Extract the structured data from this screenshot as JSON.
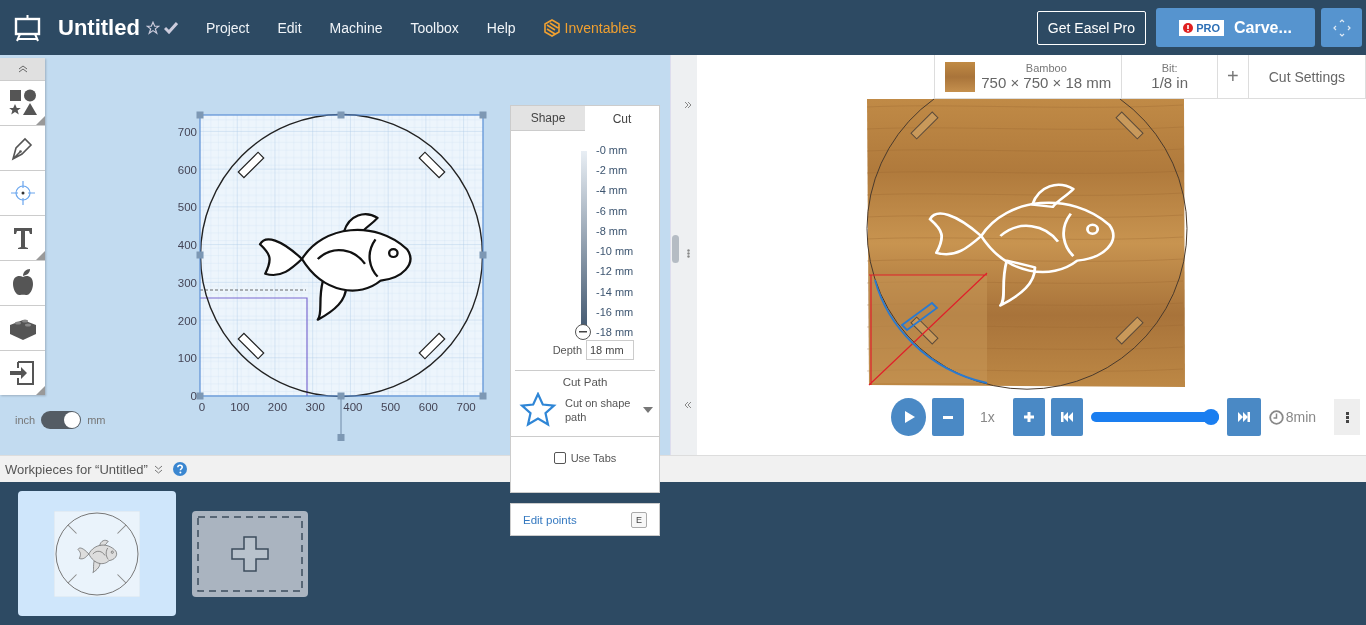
{
  "header": {
    "title": "Untitled",
    "starred": false,
    "saved": true,
    "menu": [
      "Project",
      "Edit",
      "Machine",
      "Toolbox",
      "Help"
    ],
    "brand": "Inventables",
    "pro_button": "Get Easel Pro",
    "carve_badge": "PRO",
    "carve_label": "Carve..."
  },
  "tools": [
    {
      "kind": "shapes",
      "selected": false,
      "submenu": true
    },
    {
      "kind": "pen",
      "selected": false,
      "submenu": false
    },
    {
      "kind": "target",
      "selected": true,
      "submenu": false
    },
    {
      "kind": "text",
      "selected": false,
      "submenu": true
    },
    {
      "kind": "apple",
      "selected": false,
      "submenu": false
    },
    {
      "kind": "block",
      "selected": false,
      "submenu": false
    },
    {
      "kind": "import",
      "selected": false,
      "submenu": true
    }
  ],
  "units": {
    "left": "inch",
    "right": "mm",
    "on": true
  },
  "canvas": {
    "y_labels": [
      "700",
      "600",
      "500",
      "400",
      "300",
      "200",
      "100",
      "0"
    ],
    "x_labels": [
      "0",
      "100",
      "200",
      "300",
      "400",
      "500",
      "600",
      "700"
    ]
  },
  "cut_panel": {
    "tabs": [
      {
        "label": "Shape",
        "selected": false
      },
      {
        "label": "Cut",
        "selected": true
      }
    ],
    "depth_marks": [
      "-0 mm",
      "-2 mm",
      "-4 mm",
      "-6 mm",
      "-8 mm",
      "-10 mm",
      "-12 mm",
      "-14 mm",
      "-16 mm",
      "-18 mm"
    ],
    "level": 1,
    "depth_label": "Depth",
    "depth_value": "18 mm",
    "cut_path_title": "Cut Path",
    "cut_path_option": "Cut on shape path",
    "use_tabs": {
      "label": "Use Tabs",
      "checked": false
    }
  },
  "edit_points": {
    "label": "Edit points",
    "key": "E"
  },
  "material": {
    "name": "Bamboo",
    "size": "750 × 750 × 18 mm",
    "bit_label": "Bit:",
    "bit": "1/8 in",
    "add": "+",
    "settings": "Cut Settings"
  },
  "playback": {
    "speed": "1x",
    "level": 1,
    "time": "8min"
  },
  "workpieces": {
    "title": "Workpieces for “Untitled”",
    "items": [
      {
        "selected": true
      }
    ]
  }
}
